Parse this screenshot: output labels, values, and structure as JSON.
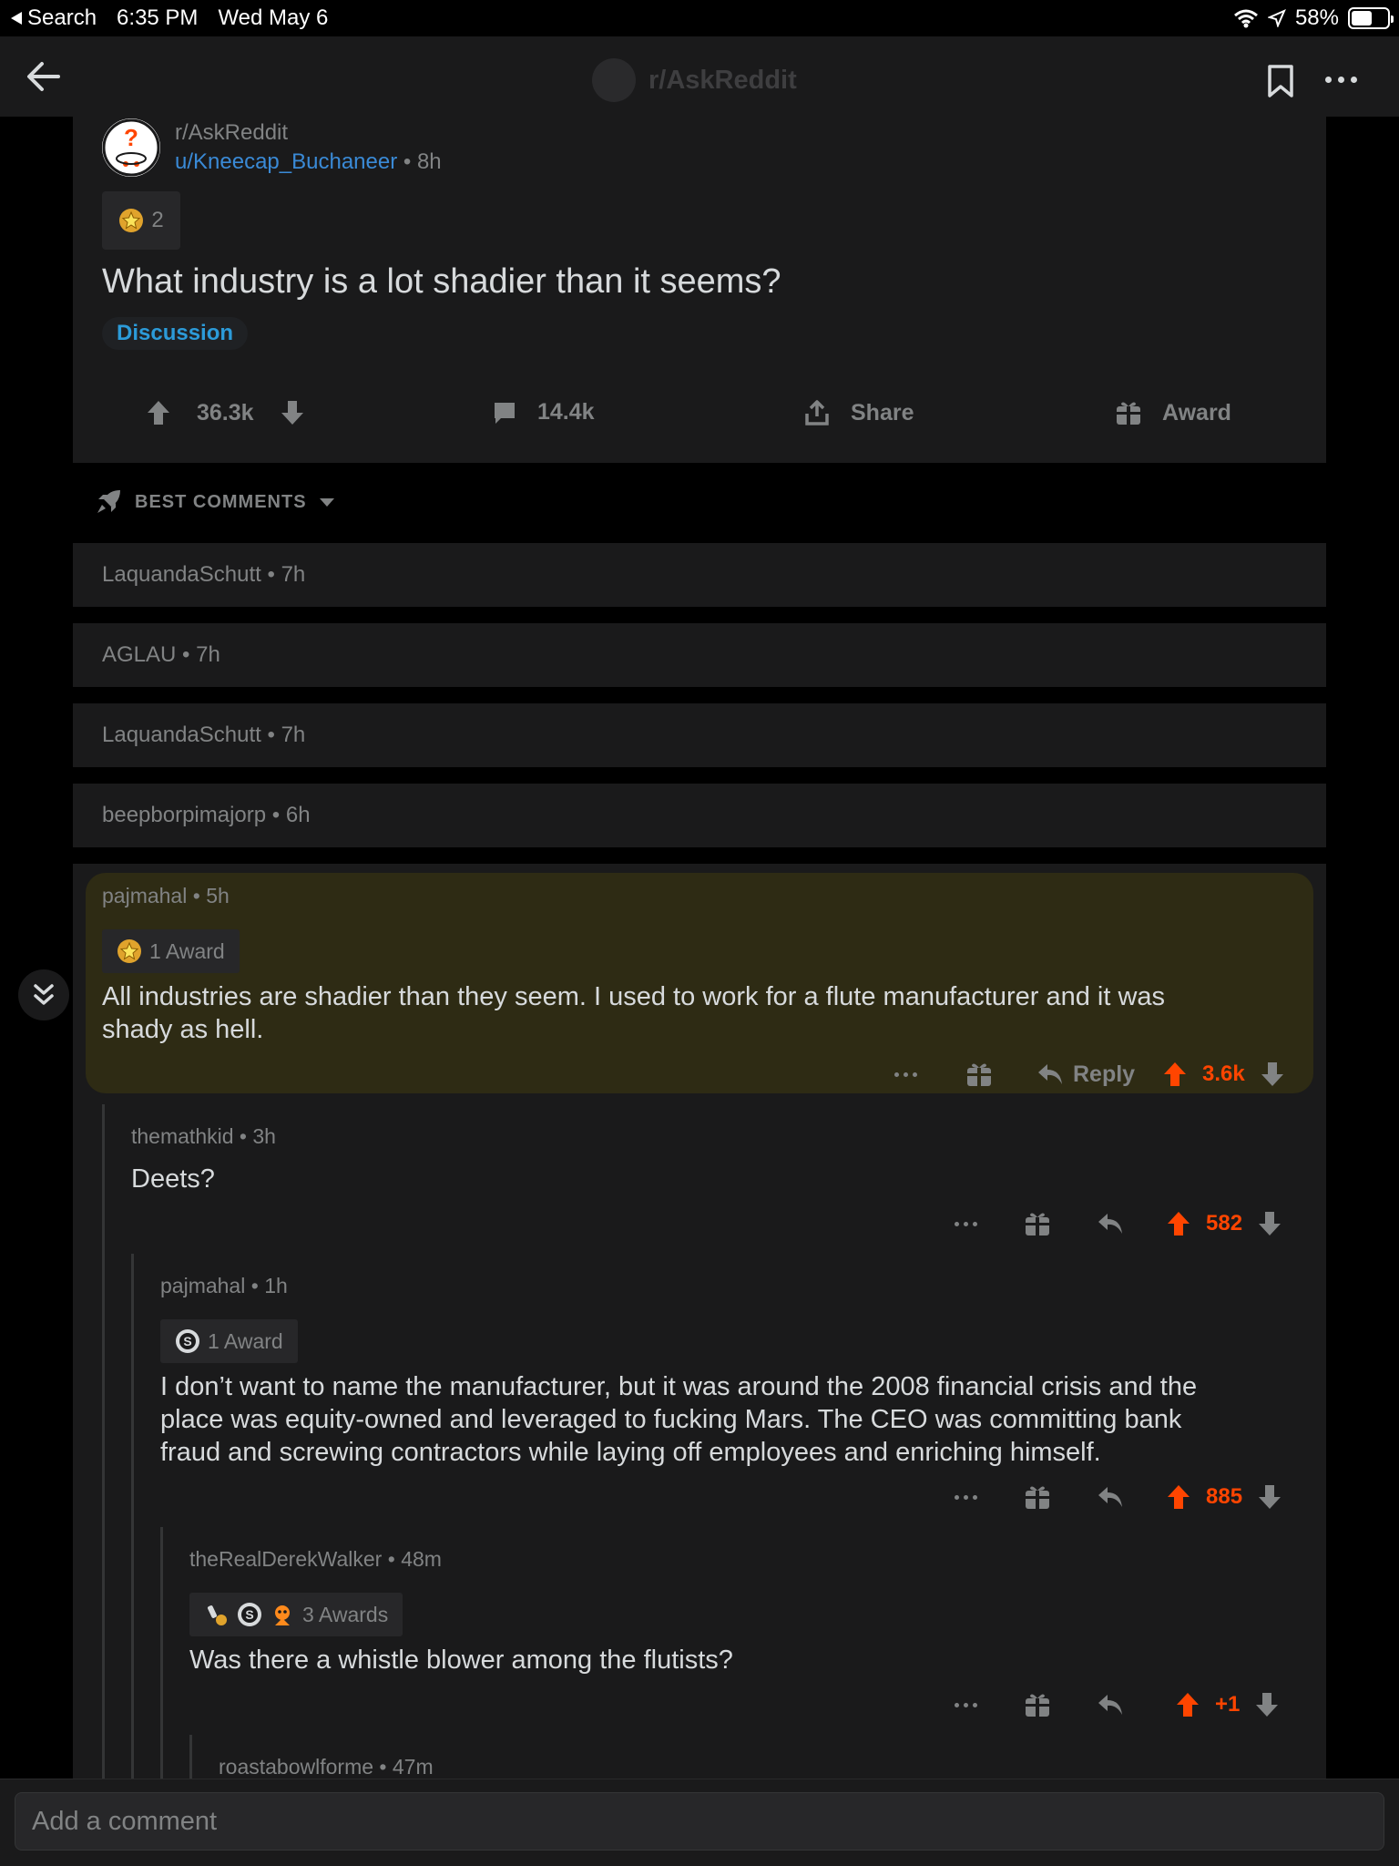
{
  "status_bar": {
    "back_app": "Search",
    "time": "6:35 PM",
    "date": "Wed May 6",
    "battery": "58%",
    "battery_level": 0.58
  },
  "nav": {
    "title": "r/AskReddit"
  },
  "post": {
    "subreddit": "r/AskReddit",
    "author": "u/Kneecap_Buchaneer",
    "age": "8h",
    "award_count": "2",
    "title": "What industry is a lot shadier than it seems?",
    "flair": "Discussion",
    "score": "36.3k",
    "comments": "14.4k",
    "share_label": "Share",
    "award_label": "Award"
  },
  "sort": {
    "label": "BEST COMMENTS"
  },
  "collapsed_comments": [
    {
      "author": "LaquandaSchutt",
      "age": "7h"
    },
    {
      "author": "AGLAU",
      "age": "7h"
    },
    {
      "author": "LaquandaSchutt",
      "age": "7h"
    },
    {
      "author": "beepborpimajorp",
      "age": "6h"
    }
  ],
  "comments": [
    {
      "author": "pajmahal",
      "age": "5h",
      "awards": "1 Award",
      "body_line1": "All industries are shadier than they seem. I used to work for a flute manufacturer and it was",
      "body_line2": "shady as hell.",
      "reply_label": "Reply",
      "score": "3.6k"
    },
    {
      "author": "themathkid",
      "age": "3h",
      "body": "Deets?",
      "score": "582"
    },
    {
      "author": "pajmahal",
      "age": "1h",
      "awards": "1 Award",
      "body_line1": "I don’t want to name the manufacturer, but it was around the 2008 financial crisis and the",
      "body_line2": "place was equity-owned and leveraged to fucking Mars. The CEO was committing bank",
      "body_line3": "fraud and screwing contractors while laying off employees and enriching himself.",
      "score": "885"
    },
    {
      "author": "theRealDerekWalker",
      "age": "48m",
      "awards": "3 Awards",
      "body": "Was there a whistle blower among the flutists?",
      "score": "+1"
    },
    {
      "author": "roastabowlforme",
      "age": "47m"
    }
  ],
  "composer": {
    "placeholder": "Add a comment"
  },
  "colors": {
    "background": "#000000",
    "surface": "#1a1a1b",
    "highlight": "#2e2b14",
    "upvote": "#ff4500",
    "link": "#3a8ad6",
    "flair": "#2c9bd9",
    "muted": "#818384"
  },
  "icons": [
    "wifi-icon",
    "location-icon",
    "back-arrow-icon",
    "bookmark-icon",
    "more-icon",
    "upvote-icon",
    "downvote-icon",
    "comment-icon",
    "share-icon",
    "gift-icon",
    "rocket-icon",
    "reply-icon",
    "collapse-icon"
  ]
}
